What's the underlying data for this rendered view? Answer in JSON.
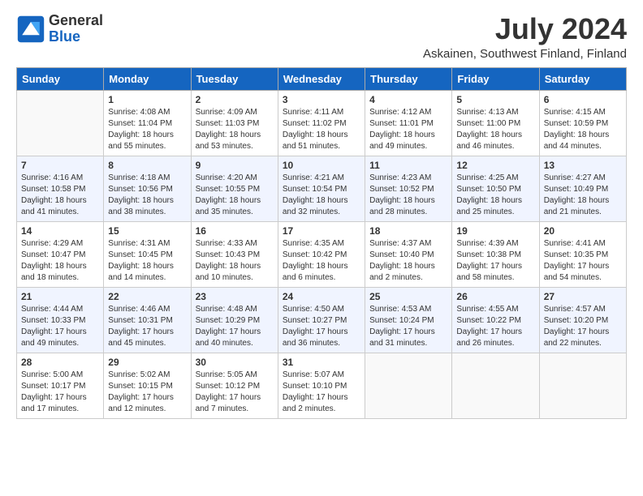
{
  "header": {
    "logo_general": "General",
    "logo_blue": "Blue",
    "month_year": "July 2024",
    "location": "Askainen, Southwest Finland, Finland"
  },
  "days_of_week": [
    "Sunday",
    "Monday",
    "Tuesday",
    "Wednesday",
    "Thursday",
    "Friday",
    "Saturday"
  ],
  "weeks": [
    [
      {
        "day": "",
        "sunrise": "",
        "sunset": "",
        "daylight": ""
      },
      {
        "day": "1",
        "sunrise": "Sunrise: 4:08 AM",
        "sunset": "Sunset: 11:04 PM",
        "daylight": "Daylight: 18 hours and 55 minutes."
      },
      {
        "day": "2",
        "sunrise": "Sunrise: 4:09 AM",
        "sunset": "Sunset: 11:03 PM",
        "daylight": "Daylight: 18 hours and 53 minutes."
      },
      {
        "day": "3",
        "sunrise": "Sunrise: 4:11 AM",
        "sunset": "Sunset: 11:02 PM",
        "daylight": "Daylight: 18 hours and 51 minutes."
      },
      {
        "day": "4",
        "sunrise": "Sunrise: 4:12 AM",
        "sunset": "Sunset: 11:01 PM",
        "daylight": "Daylight: 18 hours and 49 minutes."
      },
      {
        "day": "5",
        "sunrise": "Sunrise: 4:13 AM",
        "sunset": "Sunset: 11:00 PM",
        "daylight": "Daylight: 18 hours and 46 minutes."
      },
      {
        "day": "6",
        "sunrise": "Sunrise: 4:15 AM",
        "sunset": "Sunset: 10:59 PM",
        "daylight": "Daylight: 18 hours and 44 minutes."
      }
    ],
    [
      {
        "day": "7",
        "sunrise": "Sunrise: 4:16 AM",
        "sunset": "Sunset: 10:58 PM",
        "daylight": "Daylight: 18 hours and 41 minutes."
      },
      {
        "day": "8",
        "sunrise": "Sunrise: 4:18 AM",
        "sunset": "Sunset: 10:56 PM",
        "daylight": "Daylight: 18 hours and 38 minutes."
      },
      {
        "day": "9",
        "sunrise": "Sunrise: 4:20 AM",
        "sunset": "Sunset: 10:55 PM",
        "daylight": "Daylight: 18 hours and 35 minutes."
      },
      {
        "day": "10",
        "sunrise": "Sunrise: 4:21 AM",
        "sunset": "Sunset: 10:54 PM",
        "daylight": "Daylight: 18 hours and 32 minutes."
      },
      {
        "day": "11",
        "sunrise": "Sunrise: 4:23 AM",
        "sunset": "Sunset: 10:52 PM",
        "daylight": "Daylight: 18 hours and 28 minutes."
      },
      {
        "day": "12",
        "sunrise": "Sunrise: 4:25 AM",
        "sunset": "Sunset: 10:50 PM",
        "daylight": "Daylight: 18 hours and 25 minutes."
      },
      {
        "day": "13",
        "sunrise": "Sunrise: 4:27 AM",
        "sunset": "Sunset: 10:49 PM",
        "daylight": "Daylight: 18 hours and 21 minutes."
      }
    ],
    [
      {
        "day": "14",
        "sunrise": "Sunrise: 4:29 AM",
        "sunset": "Sunset: 10:47 PM",
        "daylight": "Daylight: 18 hours and 18 minutes."
      },
      {
        "day": "15",
        "sunrise": "Sunrise: 4:31 AM",
        "sunset": "Sunset: 10:45 PM",
        "daylight": "Daylight: 18 hours and 14 minutes."
      },
      {
        "day": "16",
        "sunrise": "Sunrise: 4:33 AM",
        "sunset": "Sunset: 10:43 PM",
        "daylight": "Daylight: 18 hours and 10 minutes."
      },
      {
        "day": "17",
        "sunrise": "Sunrise: 4:35 AM",
        "sunset": "Sunset: 10:42 PM",
        "daylight": "Daylight: 18 hours and 6 minutes."
      },
      {
        "day": "18",
        "sunrise": "Sunrise: 4:37 AM",
        "sunset": "Sunset: 10:40 PM",
        "daylight": "Daylight: 18 hours and 2 minutes."
      },
      {
        "day": "19",
        "sunrise": "Sunrise: 4:39 AM",
        "sunset": "Sunset: 10:38 PM",
        "daylight": "Daylight: 17 hours and 58 minutes."
      },
      {
        "day": "20",
        "sunrise": "Sunrise: 4:41 AM",
        "sunset": "Sunset: 10:35 PM",
        "daylight": "Daylight: 17 hours and 54 minutes."
      }
    ],
    [
      {
        "day": "21",
        "sunrise": "Sunrise: 4:44 AM",
        "sunset": "Sunset: 10:33 PM",
        "daylight": "Daylight: 17 hours and 49 minutes."
      },
      {
        "day": "22",
        "sunrise": "Sunrise: 4:46 AM",
        "sunset": "Sunset: 10:31 PM",
        "daylight": "Daylight: 17 hours and 45 minutes."
      },
      {
        "day": "23",
        "sunrise": "Sunrise: 4:48 AM",
        "sunset": "Sunset: 10:29 PM",
        "daylight": "Daylight: 17 hours and 40 minutes."
      },
      {
        "day": "24",
        "sunrise": "Sunrise: 4:50 AM",
        "sunset": "Sunset: 10:27 PM",
        "daylight": "Daylight: 17 hours and 36 minutes."
      },
      {
        "day": "25",
        "sunrise": "Sunrise: 4:53 AM",
        "sunset": "Sunset: 10:24 PM",
        "daylight": "Daylight: 17 hours and 31 minutes."
      },
      {
        "day": "26",
        "sunrise": "Sunrise: 4:55 AM",
        "sunset": "Sunset: 10:22 PM",
        "daylight": "Daylight: 17 hours and 26 minutes."
      },
      {
        "day": "27",
        "sunrise": "Sunrise: 4:57 AM",
        "sunset": "Sunset: 10:20 PM",
        "daylight": "Daylight: 17 hours and 22 minutes."
      }
    ],
    [
      {
        "day": "28",
        "sunrise": "Sunrise: 5:00 AM",
        "sunset": "Sunset: 10:17 PM",
        "daylight": "Daylight: 17 hours and 17 minutes."
      },
      {
        "day": "29",
        "sunrise": "Sunrise: 5:02 AM",
        "sunset": "Sunset: 10:15 PM",
        "daylight": "Daylight: 17 hours and 12 minutes."
      },
      {
        "day": "30",
        "sunrise": "Sunrise: 5:05 AM",
        "sunset": "Sunset: 10:12 PM",
        "daylight": "Daylight: 17 hours and 7 minutes."
      },
      {
        "day": "31",
        "sunrise": "Sunrise: 5:07 AM",
        "sunset": "Sunset: 10:10 PM",
        "daylight": "Daylight: 17 hours and 2 minutes."
      },
      {
        "day": "",
        "sunrise": "",
        "sunset": "",
        "daylight": ""
      },
      {
        "day": "",
        "sunrise": "",
        "sunset": "",
        "daylight": ""
      },
      {
        "day": "",
        "sunrise": "",
        "sunset": "",
        "daylight": ""
      }
    ]
  ]
}
